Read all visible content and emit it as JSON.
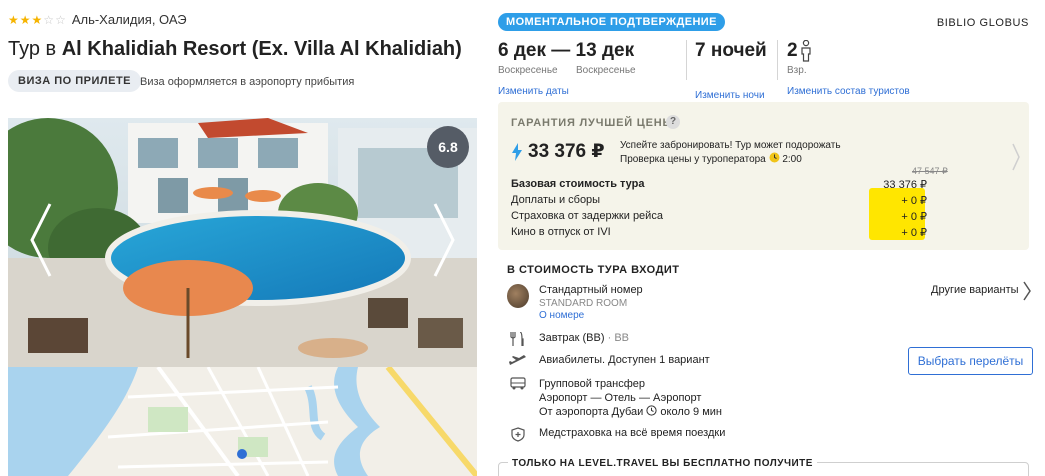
{
  "hotel": {
    "stars": 3,
    "max_stars": 5,
    "location": "Аль-Халидия, ОАЭ",
    "title_prefix": "Тур в ",
    "title_name": "Al Khalidiah Resort (Ex. Villa Al Khalidiah)",
    "visa_badge": "ВИЗА ПО ПРИЛЕТЕ",
    "visa_note": "Виза оформляется в аэропорту прибытия",
    "rating": "6.8"
  },
  "tour": {
    "instant_badge": "МОМЕНТАЛЬНОЕ ПОДТВЕРЖДЕНИЕ",
    "operator": "BIBLIO GLOBUS",
    "date_from": "6 дек",
    "date_dash": "—",
    "date_to": "13 дек",
    "day_from": "Воскресенье",
    "day_to": "Воскресенье",
    "nights": "7 ночей",
    "adults": "2",
    "adults_label": "Взр.",
    "change_dates": "Изменить даты",
    "change_nights": "Изменить ночи",
    "change_tourists": "Изменить состав туристов"
  },
  "price": {
    "guarantee": "ГАРАНТИЯ ЛУЧШЕЙ ЦЕНЫ",
    "question": "?",
    "current": "33 376 ₽",
    "hurry_line1": "Успейте забронировать! Тур может подорожать",
    "hurry_line2_prefix": "Проверка цены у туроператора",
    "hurry_time": "2:00",
    "old_price": "47 547 ₽",
    "rows": [
      {
        "label": "Базовая стоимость тура",
        "value": "33 376 ₽"
      },
      {
        "label": "Доплаты и сборы",
        "value": "+ 0 ₽"
      },
      {
        "label": "Страховка от задержки рейса",
        "value": "+ 0 ₽"
      },
      {
        "label": "Кино в отпуск от IVI",
        "value": "+ 0 ₽"
      }
    ]
  },
  "includes": {
    "title": "В СТОИМОСТЬ ТУРА ВХОДИТ",
    "room_name": "Стандартный номер",
    "room_type": "STANDARD ROOM",
    "room_link": "О номере",
    "other_variants": "Другие варианты",
    "meal": "Завтрак (BB)",
    "meal_code": "BB",
    "flights": "Авиабилеты. Доступен 1 вариант",
    "flights_button": "Выбрать перелёты",
    "transfer_title": "Групповой трансфер",
    "transfer_route": "Аэропорт — Отель — Аэропорт",
    "transfer_time_prefix": "От аэропорта Дубаи",
    "transfer_time": "около 9 мин",
    "insurance": "Медстраховка на всё время поездки",
    "free_title": "ТОЛЬКО НА LEVEL.TRAVEL ВЫ БЕСПЛАТНО ПОЛУЧИТЕ"
  },
  "colors": {
    "accent_blue": "#2e9ee8",
    "link_blue": "#2f6fd5",
    "highlight_yellow": "#ffe600",
    "star": "#f6b400"
  }
}
